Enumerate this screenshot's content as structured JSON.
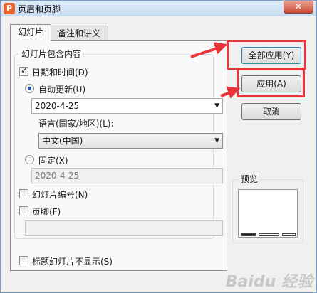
{
  "window": {
    "title": "页眉和页脚",
    "app_icon": "P",
    "close_symbol": "✕"
  },
  "tabs": [
    {
      "label": "幻灯片",
      "active": true
    },
    {
      "label": "备注和讲义",
      "active": false
    }
  ],
  "slide_content": {
    "group_label": "幻灯片包含内容",
    "date_time": {
      "label": "日期和时间(D)",
      "checked": true
    },
    "auto_update": {
      "label": "自动更新(U)",
      "selected": true,
      "value": "2020-4-25"
    },
    "language": {
      "label": "语言(国家/地区)(L):",
      "value": "中文(中国)"
    },
    "fixed": {
      "label": "固定(X)",
      "selected": false,
      "value": "2020-4-25"
    },
    "slide_number": {
      "label": "幻灯片编号(N)",
      "checked": false
    },
    "footer": {
      "label": "页脚(F)",
      "checked": false,
      "value": ""
    }
  },
  "dont_show_title": {
    "label": "标题幻灯片不显示(S)",
    "checked": false
  },
  "buttons": {
    "apply_all": "全部应用(Y)",
    "apply": "应用(A)",
    "cancel": "取消"
  },
  "preview": {
    "label": "预览"
  },
  "icons": {
    "dropdown": "▼",
    "close": "close-icon"
  },
  "colors": {
    "annotation": "#e8343a",
    "title_bar": "#dcebf9",
    "dialog_bg": "#f0f0f0"
  },
  "watermark": "Baidu 经验"
}
